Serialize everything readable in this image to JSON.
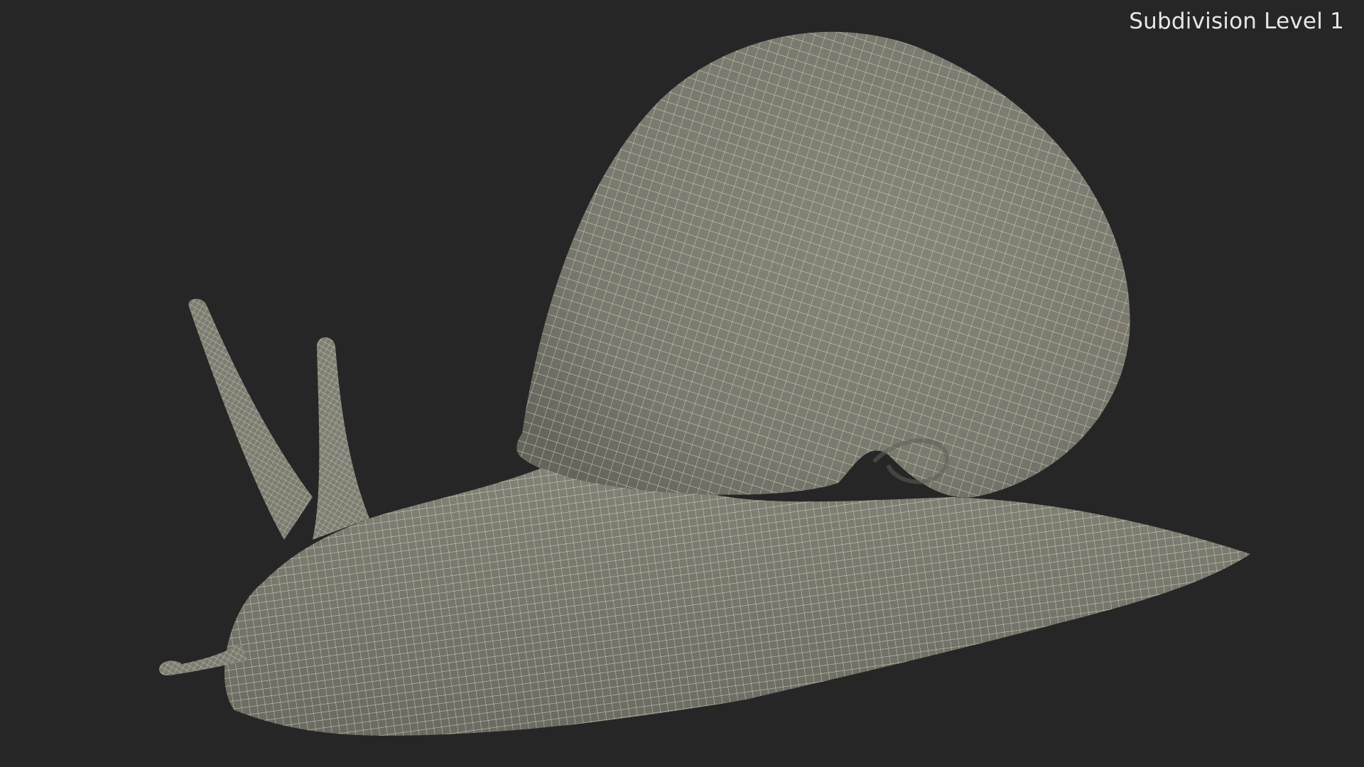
{
  "viewport": {
    "label": "Subdivision Level 1",
    "background_color": "#262626",
    "label_color": "#e6e6e6"
  },
  "model": {
    "subject": "snail",
    "render_style": "wireframe",
    "surface_color": "#7b7a6f",
    "wire_color": "#e8e4d2",
    "shadow_color": "#5f5e55"
  }
}
